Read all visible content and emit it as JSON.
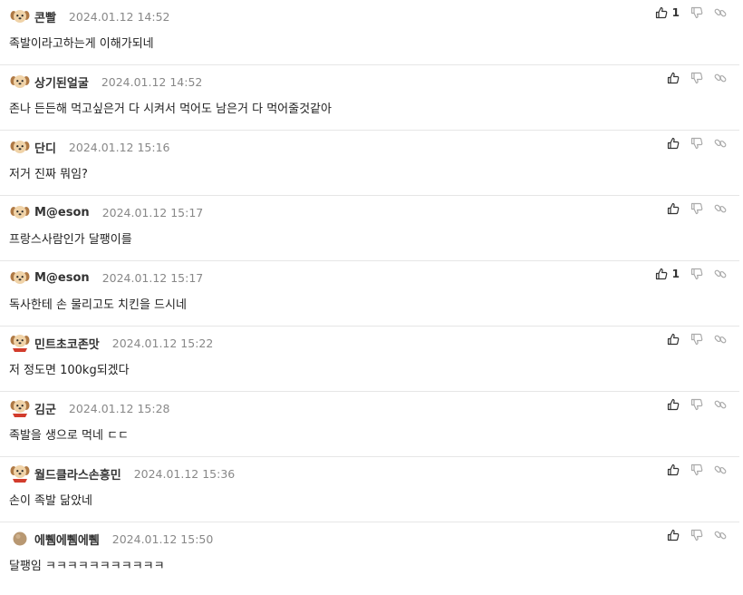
{
  "comments": [
    {
      "nickname": "콘빨",
      "date": "2024.01.12 14:52",
      "text": "족발이라고하는게 이해가되네",
      "likes": "1",
      "avatar": "puppy-icon"
    },
    {
      "nickname": "상기된얼굴",
      "date": "2024.01.12 14:52",
      "text": "존나 든든해 먹고싶은거 다 시켜서 먹어도 남은거 다 먹어줄것같아",
      "likes": "",
      "avatar": "puppy-icon"
    },
    {
      "nickname": "단디",
      "date": "2024.01.12 15:16",
      "text": "저거 진짜 뭐임?",
      "likes": "",
      "avatar": "puppy-icon"
    },
    {
      "nickname": "M@eson",
      "date": "2024.01.12 15:17",
      "text": "프랑스사람인가 달팽이를",
      "likes": "",
      "avatar": "puppy-icon"
    },
    {
      "nickname": "M@eson",
      "date": "2024.01.12 15:17",
      "text": "독사한테 손 물리고도 치킨을 드시네",
      "likes": "1",
      "avatar": "puppy-icon"
    },
    {
      "nickname": "민트초코존맛",
      "date": "2024.01.12 15:22",
      "text": "저 정도면 100kg되겠다",
      "likes": "",
      "avatar": "puppy-red-icon"
    },
    {
      "nickname": "김군",
      "date": "2024.01.12 15:28",
      "text": "족발을 생으로 먹네 ㄷㄷ",
      "likes": "",
      "avatar": "puppy-red-icon"
    },
    {
      "nickname": "월드클라스손흥민",
      "date": "2024.01.12 15:36",
      "text": "손이 족발 닮았네",
      "likes": "",
      "avatar": "puppy-red-icon"
    },
    {
      "nickname": "에쀔에쀔에쀔",
      "date": "2024.01.12 15:50",
      "text": "달팽임 ㅋㅋㅋㅋㅋㅋㅋㅋㅋㅋㅋ",
      "likes": "",
      "avatar": "circle-avatar-icon"
    }
  ],
  "colors": {
    "text": "#222222",
    "date": "#888888",
    "divider": "#e6e6e6",
    "icon": "#333333",
    "icon_muted": "#aaaaaa"
  }
}
